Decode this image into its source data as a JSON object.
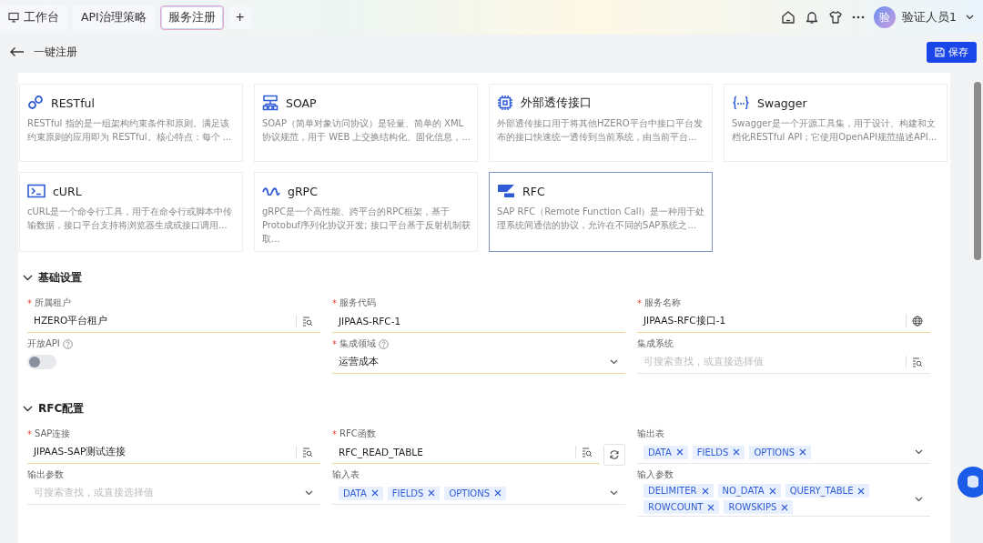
{
  "tabs": [
    {
      "label": "工作台",
      "selected": false
    },
    {
      "label": "API治理策略",
      "selected": false
    },
    {
      "label": "服务注册",
      "selected": true
    }
  ],
  "add_tab": "+",
  "user": {
    "avatar": "验",
    "name": "验证人员1"
  },
  "header": {
    "title": "一键注册",
    "save": "保存"
  },
  "cards": [
    {
      "title": "RESTful",
      "desc": "RESTful 指的是一组架构约束条件和原则。满足该约束原则的应用即为 RESTful。核心特点：每个 ...",
      "selected": false
    },
    {
      "title": "SOAP",
      "desc": "SOAP（简单对象访问协议）是轻量、简单的 XML 协议规范，用于 WEB 上交换结构化、固化信息，...",
      "selected": false
    },
    {
      "title": "外部透传接口",
      "desc": "外部透传接口用于将其他HZERO平台中接口平台发布的接口快速统一透传到当前系统，由当前平台...",
      "selected": false
    },
    {
      "title": "Swagger",
      "desc": "Swagger是一个开源工具集，用于设计、构建和文档化RESTful API；它使用OpenAPI规范描述API...",
      "selected": false
    },
    {
      "title": "cURL",
      "desc": "cURL是一个命令行工具，用于在命令行或脚本中传输数据，接口平台支持将浏览器生成或接口调用...",
      "selected": false
    },
    {
      "title": "gRPC",
      "desc": "gRPC是一个高性能、跨平台的RPC框架，基于Protobuf序列化协议开发; 接口平台基于反射机制获取...",
      "selected": false
    },
    {
      "title": "RFC",
      "desc": "SAP RFC（Remote Function Call）是一种用于处理系统间通信的协议，允许在不同的SAP系统之...",
      "selected": true
    }
  ],
  "sections": [
    {
      "title": "基础设置",
      "expanded": true,
      "fields": [
        {
          "kind": "lov",
          "asterisk": "*",
          "label": "所属租户",
          "value": "HZERO平台租户"
        },
        {
          "kind": "text",
          "asterisk": "*",
          "label": "服务代码",
          "value": "JIPAAS-RFC-1"
        },
        {
          "kind": "i18n",
          "asterisk": "*",
          "label": "服务名称",
          "value": "JIPAAS-RFC接口-1"
        },
        {
          "kind": "switch",
          "label": "开放API",
          "help": true,
          "on": false
        },
        {
          "kind": "select",
          "asterisk": "*",
          "label": "集成领域",
          "help": true,
          "value": "运营成本"
        },
        {
          "kind": "lov",
          "label": "集成系统",
          "placeholder": "可搜索查找，或直接选择值"
        }
      ]
    },
    {
      "title": "RFC配置",
      "expanded": true,
      "fields": [
        {
          "kind": "lov",
          "asterisk": "*",
          "label": "SAP连接",
          "value": "JIPAAS-SAP测试连接"
        },
        {
          "kind": "lov-refresh",
          "asterisk": "*",
          "label": "RFC函数",
          "value": "RFC_READ_TABLE"
        },
        {
          "kind": "tags",
          "label": "输出表",
          "tags": [
            "DATA",
            "FIELDS",
            "OPTIONS"
          ]
        },
        {
          "kind": "select",
          "label": "输出参数",
          "placeholder": "可搜索查找，或直接选择值"
        },
        {
          "kind": "tags",
          "label": "输入表",
          "tags": [
            "DATA",
            "FIELDS",
            "OPTIONS"
          ]
        },
        {
          "kind": "tags",
          "label": "输入参数",
          "tags": [
            "DELIMITER",
            "NO_DATA",
            "QUERY_TABLE",
            "ROWCOUNT",
            "ROWSKIPS"
          ]
        }
      ]
    }
  ]
}
